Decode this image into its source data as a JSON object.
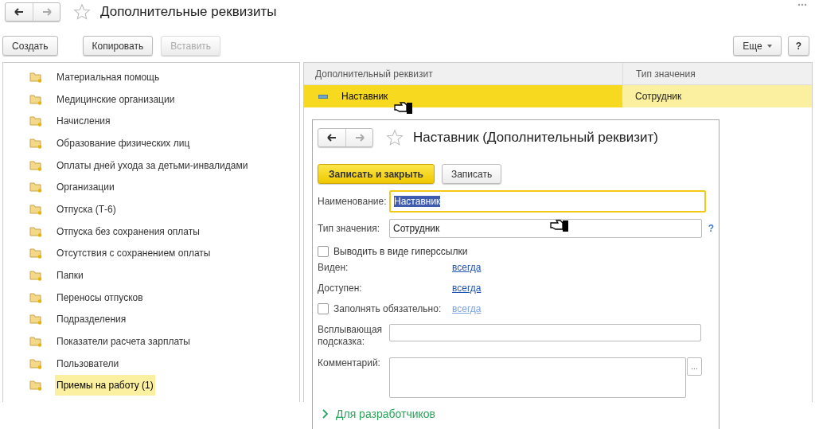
{
  "window": {
    "title": "Дополнительные реквизиты"
  },
  "toolbar": {
    "buttons": [
      {
        "label": "Создать",
        "disabled": false
      },
      {
        "label": "Копировать",
        "disabled": false
      },
      {
        "label": "Вставить",
        "disabled": true
      }
    ],
    "more": "Еще",
    "help": "?"
  },
  "groups": [
    {
      "label": "Материальная помощь",
      "selected": false
    },
    {
      "label": "Медицинские организации",
      "selected": false
    },
    {
      "label": "Начисления",
      "selected": false
    },
    {
      "label": "Образование физических лиц",
      "selected": false
    },
    {
      "label": "Оплаты дней ухода за детьми-инвалидами",
      "selected": false
    },
    {
      "label": "Организации",
      "selected": false
    },
    {
      "label": "Отпуска (Т-6)",
      "selected": false
    },
    {
      "label": "Отпуска без сохранения оплаты",
      "selected": false
    },
    {
      "label": "Отсутствия с сохранением оплаты",
      "selected": false
    },
    {
      "label": "Папки",
      "selected": false
    },
    {
      "label": "Переносы отпусков",
      "selected": false
    },
    {
      "label": "Подразделения",
      "selected": false
    },
    {
      "label": "Показатели расчета зарплаты",
      "selected": false
    },
    {
      "label": "Пользователи",
      "selected": false
    },
    {
      "label": "Приемы на работу (1)",
      "selected": true
    }
  ],
  "table": {
    "columns": [
      "Дополнительный реквизит",
      "Тип значения"
    ],
    "rows": [
      {
        "cells": [
          "Наставник",
          "Сотрудник"
        ],
        "selected": true
      }
    ]
  },
  "dialog": {
    "title": "Наставник (Дополнительный реквизит)",
    "buttons": [
      {
        "label": "Записать и закрыть",
        "primary": true
      },
      {
        "label": "Записать",
        "primary": false
      }
    ],
    "name": {
      "label": "Наименование:",
      "value": "Наставник",
      "focused": true
    },
    "type": {
      "label": "Тип значения:",
      "value": "Сотрудник",
      "help": "?"
    },
    "hyperlink": {
      "label": "Выводить в виде гиперссылки",
      "checked": false
    },
    "options": [
      {
        "kind": "plain",
        "label": "Виден:",
        "link": "всегда",
        "disabled": false
      },
      {
        "kind": "plain",
        "label": "Доступен:",
        "link": "всегда",
        "disabled": false
      },
      {
        "kind": "checkbox",
        "label": "Заполнять обязательно:",
        "link": "всегда",
        "disabled": true,
        "checked": false
      }
    ],
    "tooltip": {
      "label": "Всплывающая подсказка:"
    },
    "comment": {
      "label": "Комментарий:",
      "button": "..."
    },
    "section": {
      "label": "Для разработчиков",
      "expanded": false
    }
  }
}
